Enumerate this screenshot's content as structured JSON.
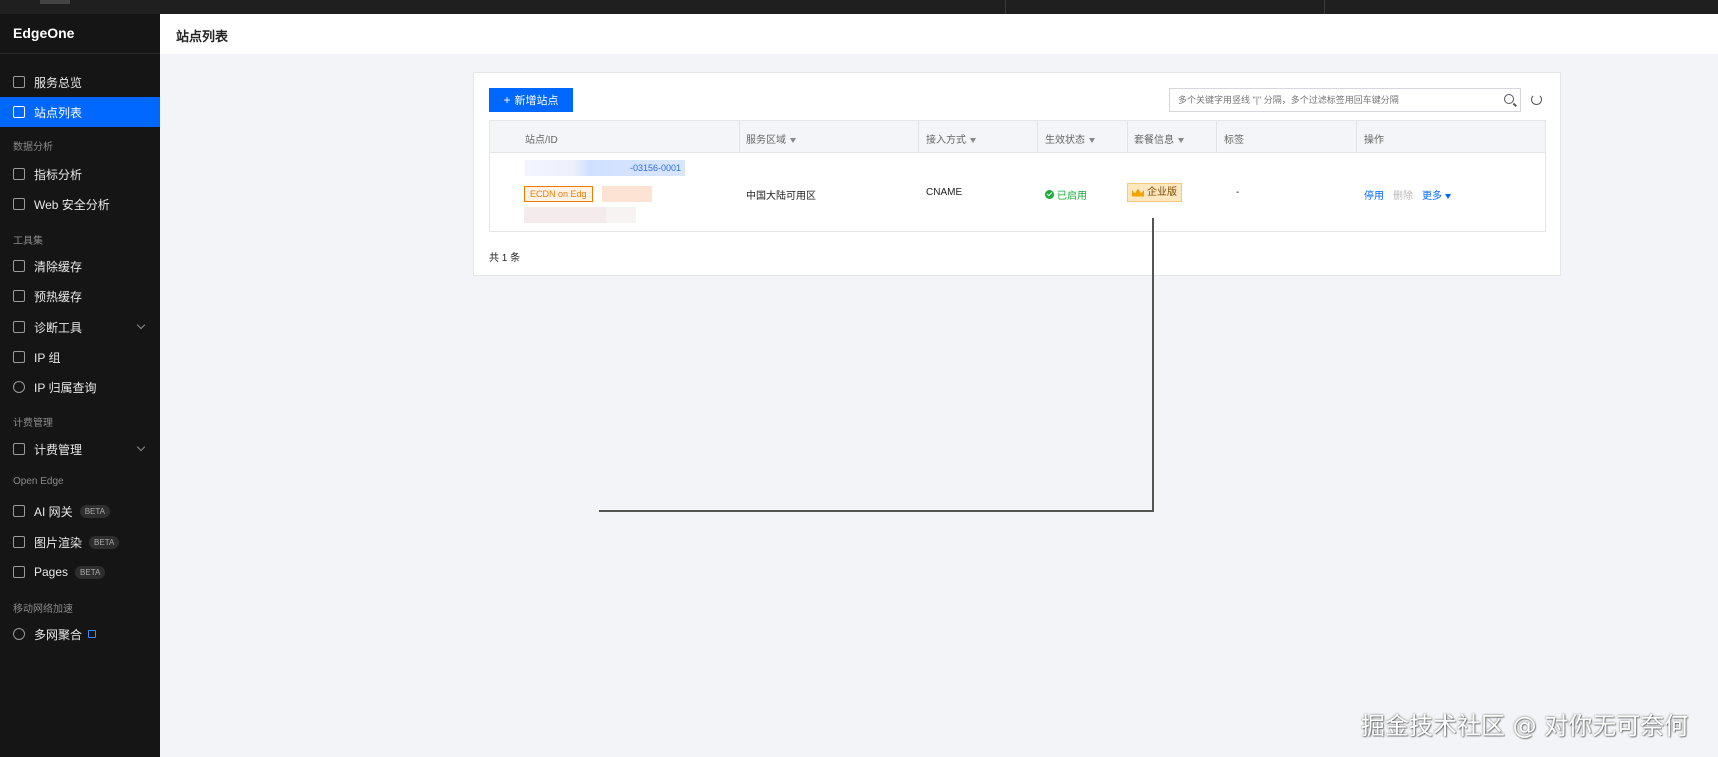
{
  "app": {
    "brand": "EdgeOne"
  },
  "sidebar": {
    "items": [
      {
        "label": "服务总览",
        "icon": "dashboard-icon",
        "active": false
      },
      {
        "label": "站点列表",
        "icon": "list-icon",
        "active": true
      }
    ],
    "groups": [
      {
        "label": "数据分析",
        "items": [
          {
            "label": "指标分析",
            "icon": "chart-icon"
          },
          {
            "label": "Web 安全分析",
            "icon": "shield-icon"
          }
        ]
      },
      {
        "label": "工具集",
        "items": [
          {
            "label": "清除缓存",
            "icon": "purge-icon"
          },
          {
            "label": "预热缓存",
            "icon": "prefetch-icon"
          },
          {
            "label": "诊断工具",
            "icon": "diagnose-icon",
            "expandable": true
          },
          {
            "label": "IP 组",
            "icon": "ip-group-icon"
          },
          {
            "label": "IP 归属查询",
            "icon": "search-icon"
          }
        ]
      },
      {
        "label": "计费管理",
        "items": [
          {
            "label": "计费管理",
            "icon": "billing-icon",
            "expandable": true
          }
        ]
      },
      {
        "label": "Open Edge",
        "items": [
          {
            "label": "AI 网关",
            "icon": "ai-gateway-icon",
            "badge": "BETA"
          },
          {
            "label": "图片渲染",
            "icon": "image-icon",
            "badge": "BETA"
          },
          {
            "label": "Pages",
            "icon": "pages-icon",
            "badge": "BETA"
          }
        ]
      },
      {
        "label": "移动网络加速",
        "items": [
          {
            "label": "多网聚合",
            "icon": "network-icon",
            "external": true
          }
        ]
      }
    ]
  },
  "header": {
    "title": "站点列表"
  },
  "toolbar": {
    "add_label": "新增站点",
    "search_placeholder": "多个关键字用竖线 \"|\" 分隔，多个过滤标签用回车键分隔"
  },
  "table": {
    "columns": [
      "站点/ID",
      "服务区域",
      "接入方式",
      "生效状态",
      "套餐信息",
      "标签",
      "操作"
    ],
    "rows": [
      {
        "site_id": "-03156-0001",
        "tag": "ECDN on Edg",
        "region": "中国大陆可用区",
        "access": "CNAME",
        "status": "已启用",
        "plan": "企业版",
        "labels": "-",
        "actions": [
          "停用",
          "删除",
          "更多"
        ]
      }
    ],
    "total": "共 1 条"
  },
  "colors": {
    "primary": "#0067ff",
    "success": "#1aab3a",
    "warning": "#f07b00",
    "sidebar_bg": "#151515"
  },
  "watermark": "掘金技术社区 @ 对你无可奈何"
}
